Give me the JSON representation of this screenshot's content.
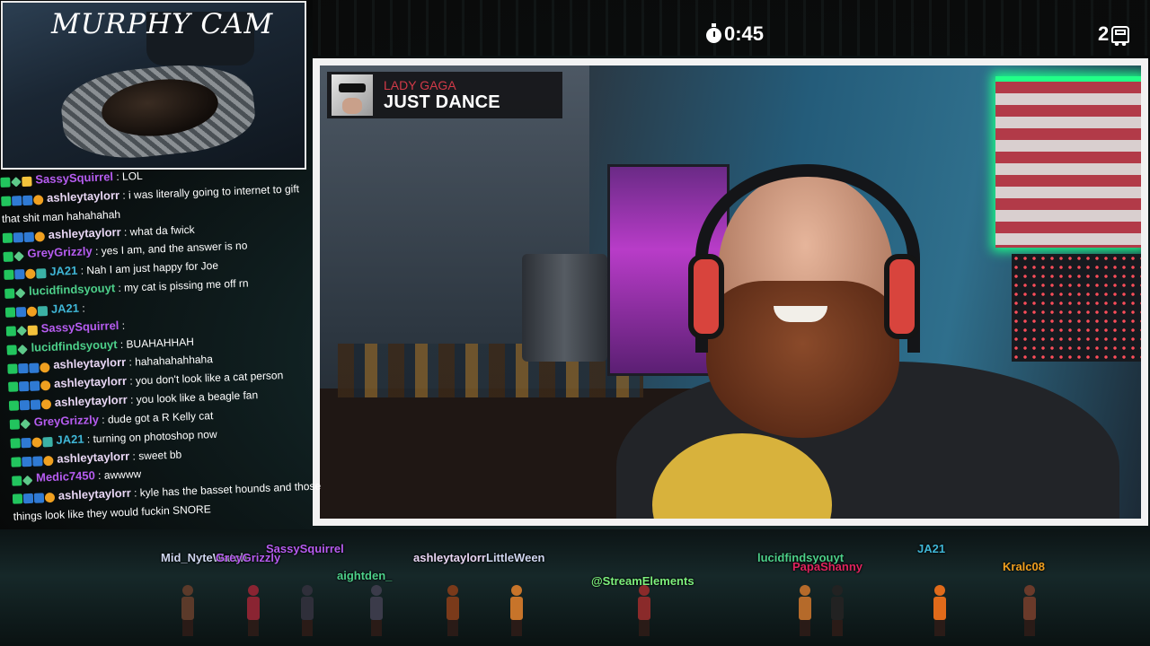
{
  "cam": {
    "title": "MURPHY CAM"
  },
  "timer": {
    "value": "0:45"
  },
  "counter": {
    "value": "2"
  },
  "now_playing": {
    "artist": "LADY GAGA",
    "title": "JUST DANCE"
  },
  "colors": {
    "frame": "#f2f2f2",
    "artist_red": "#d23a48",
    "chat_purple": "#b65cf0",
    "chat_green": "#4dd08a",
    "chat_teal": "#3fb6d6",
    "bg_teal": "#1d3b3c"
  },
  "chat": {
    "messages": [
      {
        "user": "SassySquirrel",
        "text": ": LOL",
        "color": "#b65cf0",
        "badges": [
          "k",
          "d",
          "s"
        ]
      },
      {
        "user": "ashleytaylorr",
        "text": ": i was literally going to internet to gift",
        "color": "#e9d7f5",
        "badges": [
          "k",
          "m",
          "m",
          "o"
        ]
      },
      {
        "user": "",
        "text": "that shit man hahahahah",
        "color": "#ffffff",
        "badges": []
      },
      {
        "user": "ashleytaylorr",
        "text": ": what da fwick",
        "color": "#e9d7f5",
        "badges": [
          "k",
          "m",
          "m",
          "o"
        ]
      },
      {
        "user": "GreyGrizzly",
        "text": ": yes I am, and the answer is no",
        "color": "#b65cf0",
        "badges": [
          "k",
          "d"
        ]
      },
      {
        "user": "JA21",
        "text": ": Nah I am just happy for Joe",
        "color": "#3fb6d6",
        "badges": [
          "k",
          "m",
          "o",
          "g"
        ]
      },
      {
        "user": "lucidfindsyouyt",
        "text": ": my cat is pissing me off rn",
        "color": "#4dd08a",
        "badges": [
          "k",
          "d"
        ]
      },
      {
        "user": "JA21",
        "text": ":",
        "color": "#3fb6d6",
        "badges": [
          "k",
          "m",
          "o",
          "g"
        ]
      },
      {
        "user": "SassySquirrel",
        "text": ":",
        "color": "#b65cf0",
        "badges": [
          "k",
          "d",
          "s"
        ]
      },
      {
        "user": "lucidfindsyouyt",
        "text": ": BUAHAHHAH",
        "color": "#4dd08a",
        "badges": [
          "k",
          "d"
        ]
      },
      {
        "user": "ashleytaylorr",
        "text": ": hahahahahhaha",
        "color": "#e9d7f5",
        "badges": [
          "k",
          "m",
          "m",
          "o"
        ]
      },
      {
        "user": "ashleytaylorr",
        "text": ": you don't look like a cat person",
        "color": "#e9d7f5",
        "badges": [
          "k",
          "m",
          "m",
          "o"
        ]
      },
      {
        "user": "ashleytaylorr",
        "text": ": you look like a beagle fan",
        "color": "#e9d7f5",
        "badges": [
          "k",
          "m",
          "m",
          "o"
        ]
      },
      {
        "user": "GreyGrizzly",
        "text": ": dude got a R Kelly cat",
        "color": "#b65cf0",
        "badges": [
          "k",
          "d"
        ]
      },
      {
        "user": "JA21",
        "text": ": turning on photoshop now",
        "color": "#3fb6d6",
        "badges": [
          "k",
          "m",
          "o",
          "g"
        ]
      },
      {
        "user": "ashleytaylorr",
        "text": ": sweet bb",
        "color": "#e9d7f5",
        "badges": [
          "k",
          "m",
          "m",
          "o"
        ]
      },
      {
        "user": "Medic7450",
        "text": ": awwww",
        "color": "#b65cf0",
        "badges": [
          "k",
          "d"
        ]
      },
      {
        "user": "ashleytaylorr",
        "text": ": kyle has the basset hounds and those",
        "color": "#e9d7f5",
        "badges": [
          "k",
          "m",
          "m",
          "o"
        ]
      },
      {
        "user": "",
        "text": "things look like they would fuckin SNORE",
        "color": "#ffffff",
        "badges": []
      }
    ]
  },
  "stage": {
    "avatars": [
      {
        "name": "Mid_NyteWatch",
        "color": "#cfd7f0"
      },
      {
        "name": "GreyGrizzly",
        "color": "#b65cf0"
      },
      {
        "name": "SassySquirrel",
        "color": "#b65cf0"
      },
      {
        "name": "aightden_",
        "color": "#4dd08a"
      },
      {
        "name": "ashleytaylorr",
        "color": "#e9d7f5"
      },
      {
        "name": "LittleWeen",
        "color": "#cfd7f0"
      },
      {
        "name": "@StreamElements",
        "color": "#7df07d"
      },
      {
        "name": "lucidfindsyouyt",
        "color": "#4dd08a"
      },
      {
        "name": "PapaShanny",
        "color": "#e0245e"
      },
      {
        "name": "JA21",
        "color": "#3fb6d6"
      },
      {
        "name": "Kralc08",
        "color": "#f0a020"
      }
    ]
  }
}
